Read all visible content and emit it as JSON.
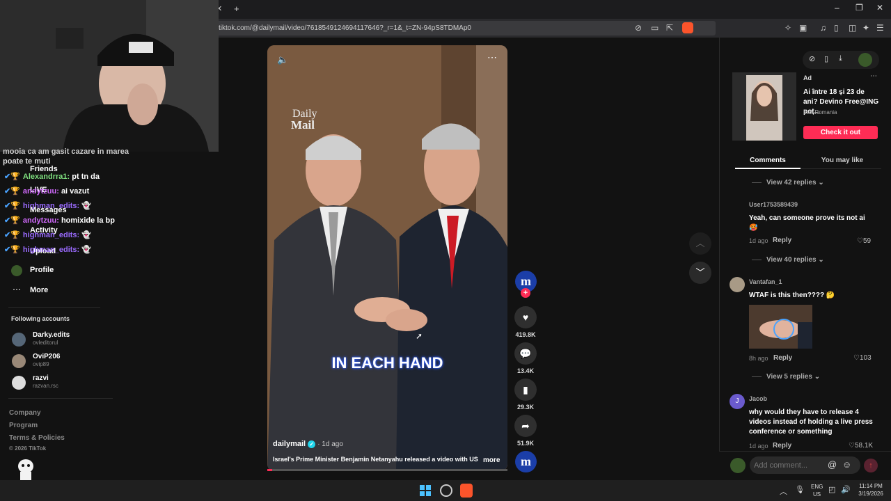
{
  "browser": {
    "close_tab": "✕",
    "new_tab": "+",
    "url": "tiktok.com/@dailymail/video/7618549124694117646?_r=1&_t=ZN-94pS8TDMAp0",
    "minimize": "–",
    "restore": "❐",
    "close": "✕"
  },
  "chat": {
    "lines": [
      {
        "name": "",
        "msg": "mooia ca am gasit cazare in marea"
      },
      {
        "name": "",
        "msg": "poate te muti"
      },
      {
        "name": "Alexandrra1:",
        "msg": "pt tn da",
        "color": "#7fe07f"
      },
      {
        "name": "andytzuu:",
        "msg": "ai vazut",
        "color": "#d36bff"
      },
      {
        "name": "highman_edits:",
        "msg": "",
        "color": "#9b6bff"
      },
      {
        "name": "andytzuu:",
        "msg": "homixide la bp",
        "color": "#d36bff"
      },
      {
        "name": "highman_edits:",
        "msg": "",
        "color": "#9b6bff"
      },
      {
        "name": "highman_edits:",
        "msg": "",
        "color": "#9b6bff"
      }
    ]
  },
  "nav": {
    "friends": "Friends",
    "live": "LIVE",
    "messages": "Messages",
    "activity": "Activity",
    "upload": "Upload",
    "profile": "Profile",
    "more": "More"
  },
  "following": {
    "title": "Following accounts",
    "accounts": [
      {
        "name": "Darky.edits",
        "handle": "ovleditorul"
      },
      {
        "name": "OviP206",
        "handle": "ovip89"
      },
      {
        "name": "razvi",
        "handle": "razvan.rsc"
      }
    ]
  },
  "footer": {
    "company": "Company",
    "program": "Program",
    "terms": "Terms & Policies",
    "copyright": "© 2026 TikTok"
  },
  "video": {
    "watermark_line1": "Daily",
    "watermark_line2": "Mail",
    "caption_overlay": "IN EACH HAND",
    "author": "dailymail",
    "time": "· 1d ago",
    "description": "Israel's Prime Minister Benjamin Netanyahu released a video with US",
    "more": "more",
    "progress": 0.02
  },
  "actions": {
    "likes": "419.8K",
    "comments": "13.4K",
    "saves": "29.3K",
    "shares": "51.9K"
  },
  "ad": {
    "label": "Ad",
    "title": "Ai între 18 și 23 de ani? Devino Free@ING poț...",
    "brand": "ING Romania",
    "cta": "Check it out"
  },
  "tabs": {
    "comments": "Comments",
    "you_may_like": "You may like"
  },
  "comments": [
    {
      "view_replies": "View 42 replies"
    },
    {
      "user": "User1753589439",
      "text": "Yeah, can someone prove its not ai",
      "emoji": "🥵",
      "time": "1d ago",
      "reply": "Reply",
      "likes": "59"
    },
    {
      "view_replies": "View 40 replies"
    },
    {
      "user": "Vantafan_1",
      "text": "WTAF is this then???? 🤔",
      "time": "8h ago",
      "reply": "Reply",
      "likes": "103"
    },
    {
      "view_replies": "View 5 replies"
    },
    {
      "user": "Jacob",
      "text": "why would they have to release 4 videos instead of holding a live press conference or something",
      "time": "1d ago",
      "reply": "Reply",
      "likes": "58.1K"
    }
  ],
  "add_comment": {
    "placeholder": "Add comment..."
  },
  "taskbar": {
    "lang1": "ENG",
    "lang2": "US",
    "time": "11:14 PM",
    "date": "3/19/2026"
  },
  "colors": {
    "accent": "#fe2c55",
    "dailymail_blue": "#1b3ea8"
  }
}
